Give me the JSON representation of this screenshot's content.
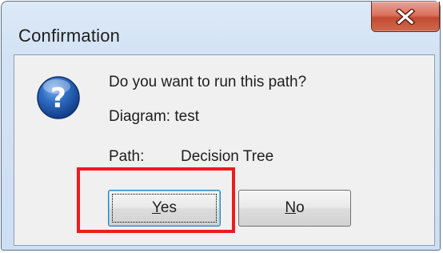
{
  "dialog": {
    "title": "Confirmation",
    "icon": "question-icon",
    "question": "Do you want to run this path?",
    "diagram_line": "Diagram: test",
    "path_label": "Path:",
    "path_value": "Decision Tree"
  },
  "buttons": {
    "yes_label": "Yes",
    "no_label": "No",
    "close_icon": "close-icon"
  },
  "annotation": {
    "highlight_color": "#ef1b1b",
    "highlight_target": "yes-button"
  }
}
